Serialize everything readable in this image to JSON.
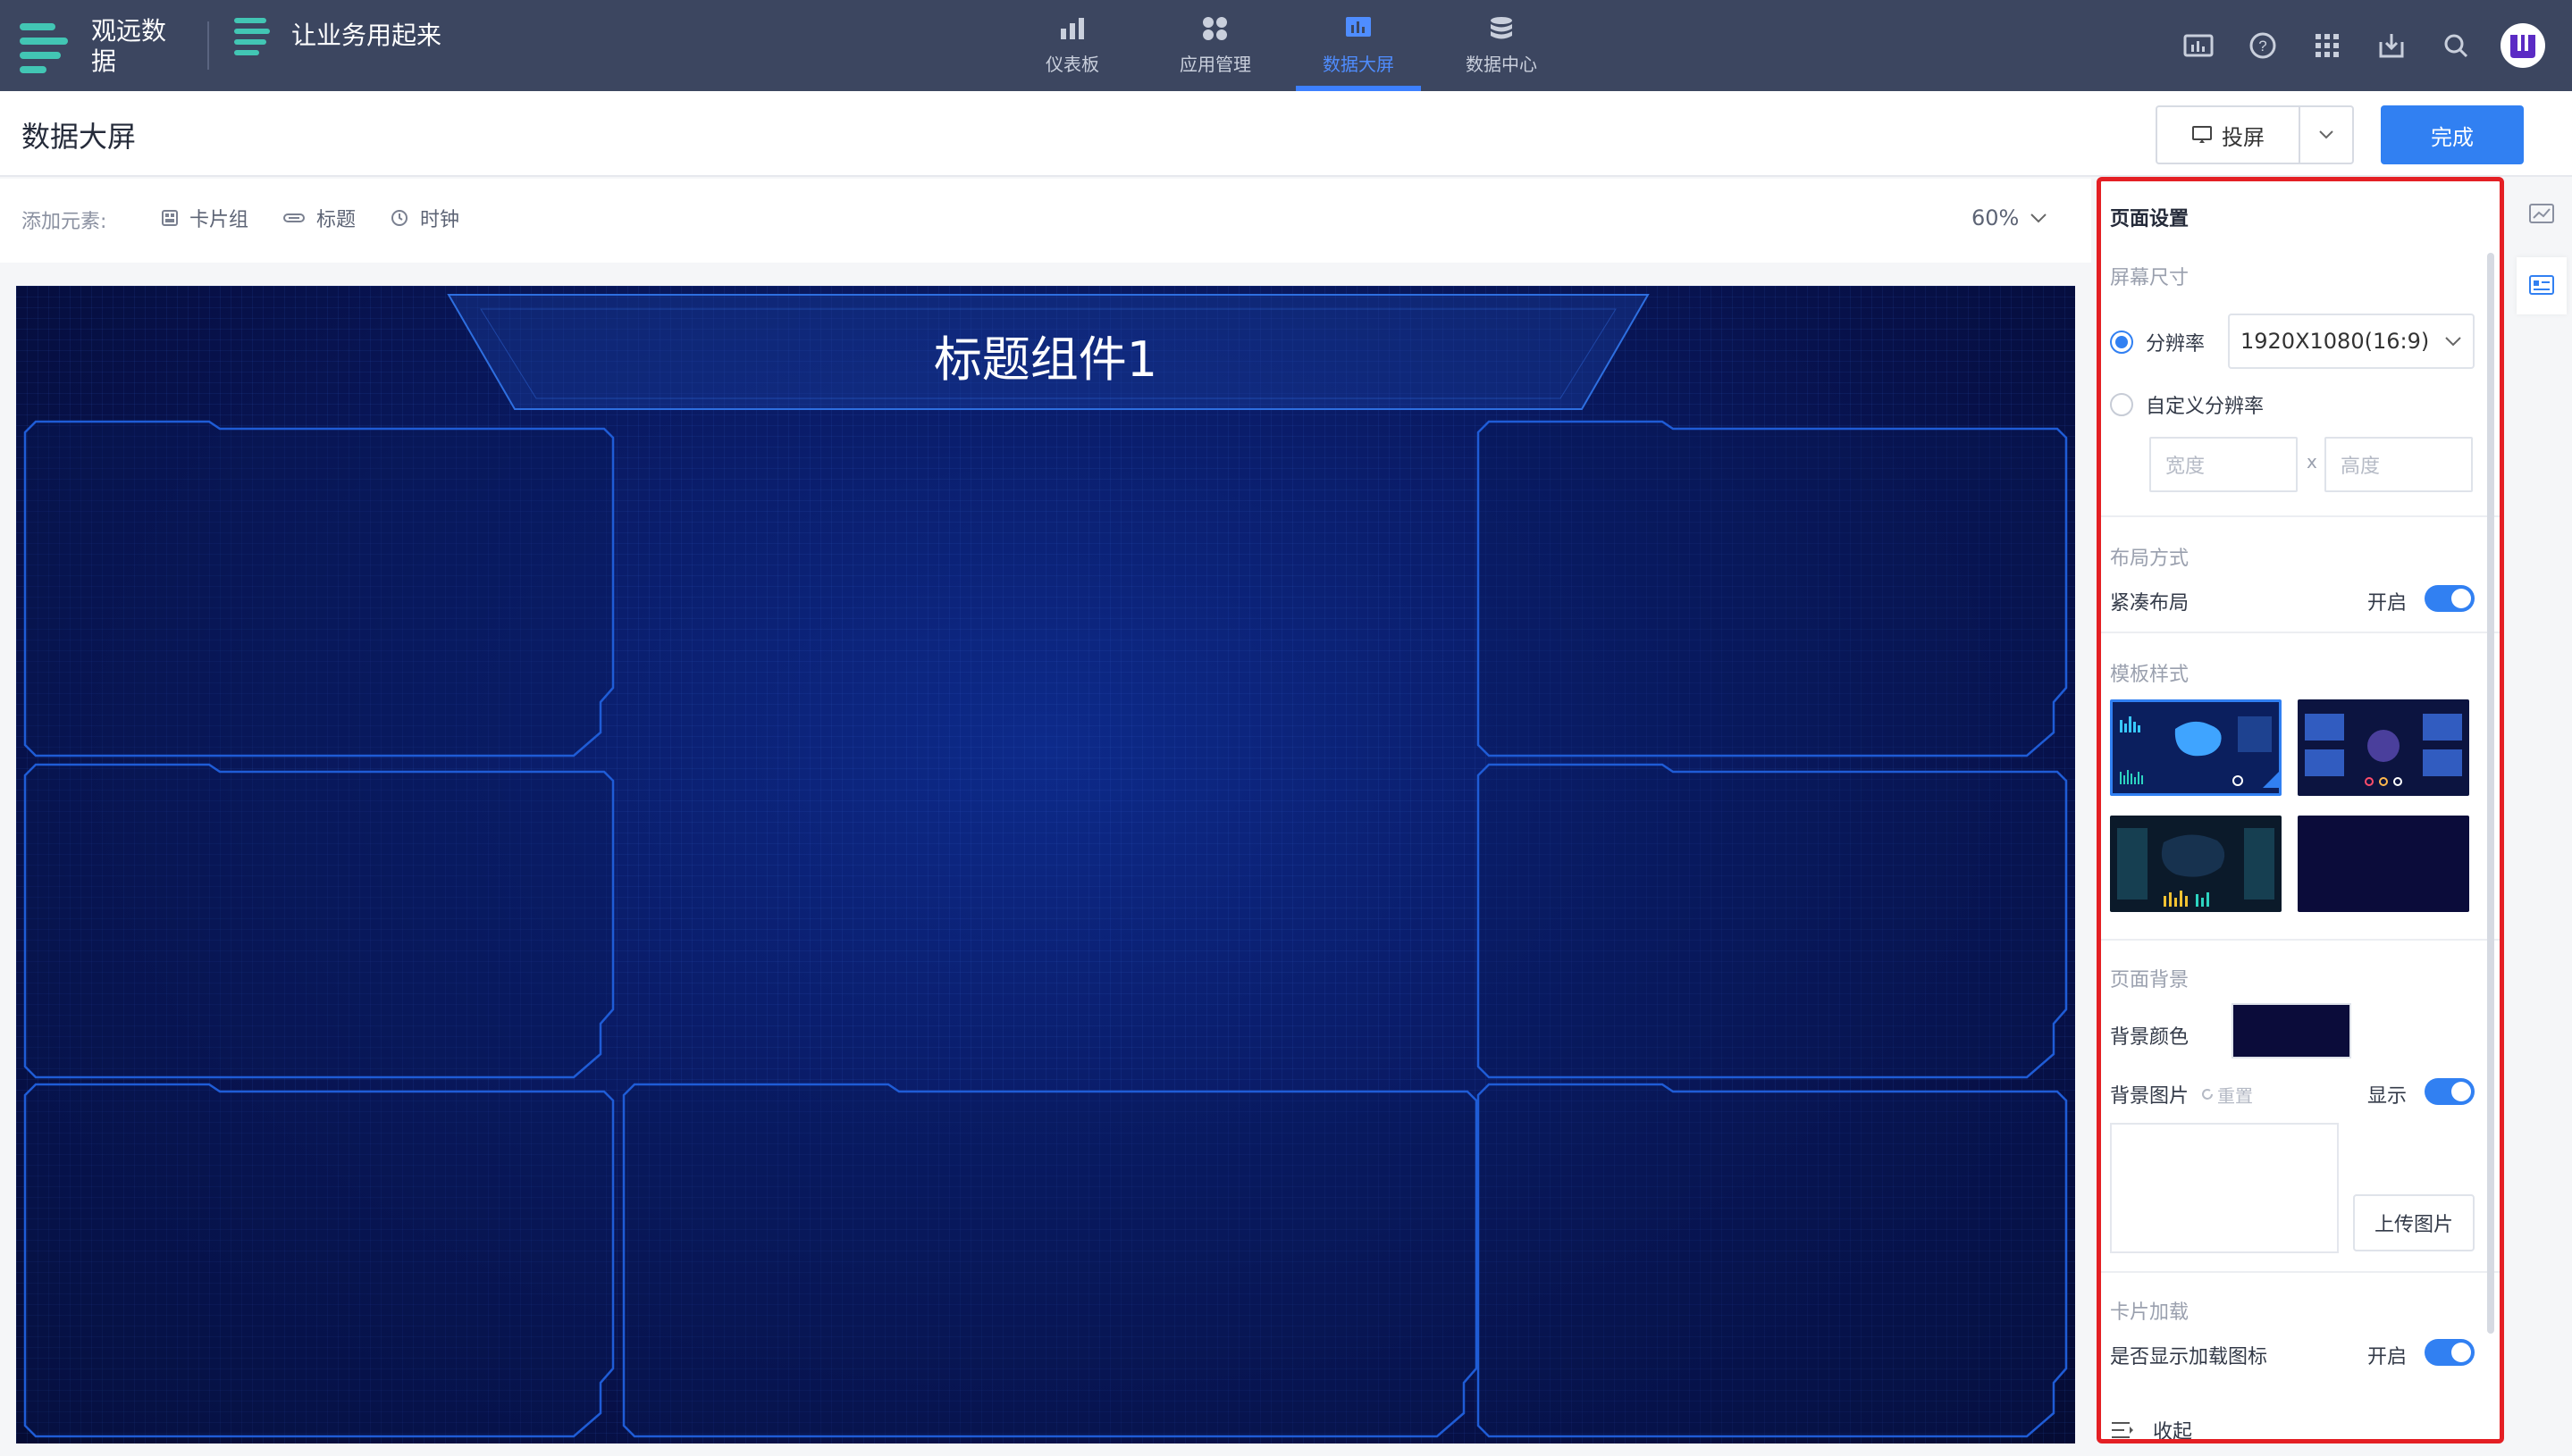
{
  "topbar": {
    "brand": "观远数据",
    "app": "让业务用起来",
    "nav": [
      {
        "label": "仪表板",
        "icon": "bar-chart-icon",
        "active": false
      },
      {
        "label": "应用管理",
        "icon": "apps-grid-icon",
        "active": false
      },
      {
        "label": "数据大屏",
        "icon": "screen-chart-icon",
        "active": true
      },
      {
        "label": "数据中心",
        "icon": "database-icon",
        "active": false
      }
    ],
    "icons": [
      "screen-icon",
      "help-icon",
      "apps-icon",
      "download-icon",
      "search-icon"
    ]
  },
  "header": {
    "title": "数据大屏",
    "cast_label": "投屏",
    "done_label": "完成"
  },
  "toolbar": {
    "label": "添加元素:",
    "items": [
      "卡片组",
      "标题",
      "时钟"
    ],
    "zoom": "60%"
  },
  "canvas": {
    "title": "标题组件1"
  },
  "panel": {
    "title": "页面设置",
    "screen_size": {
      "section": "屏幕尺寸",
      "resolution_label": "分辨率",
      "resolution_value": "1920X1080(16:9)",
      "custom_label": "自定义分辨率",
      "width_placeholder": "宽度",
      "x": "x",
      "height_placeholder": "高度"
    },
    "layout": {
      "section": "布局方式",
      "compact_label": "紧凑布局",
      "state": "开启"
    },
    "template": {
      "section": "模板样式"
    },
    "background": {
      "section": "页面背景",
      "color_label": "背景颜色",
      "color": "#0b0c3a",
      "image_label": "背景图片",
      "reset_label": "重置",
      "show_label": "显示",
      "upload_label": "上传图片"
    },
    "card_loading": {
      "section": "卡片加载",
      "show_icon_label": "是否显示加载图标",
      "state": "开启"
    },
    "collapse_label": "收起"
  },
  "colors": {
    "accent": "#3180f2",
    "topbar": "#3c4660",
    "highlight_border": "#e41f24"
  }
}
